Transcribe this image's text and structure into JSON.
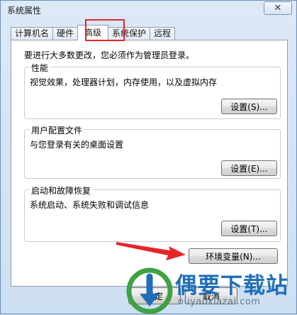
{
  "window": {
    "title": "系统属性",
    "close_glyph": "✕"
  },
  "tabs": [
    {
      "label": "计算机名",
      "active": false
    },
    {
      "label": "硬件",
      "active": false
    },
    {
      "label": "高级",
      "active": true
    },
    {
      "label": "系统保护",
      "active": false
    },
    {
      "label": "远程",
      "active": false
    }
  ],
  "intro": "要进行大多数更改，您必须作为管理员登录。",
  "groups": {
    "performance": {
      "title": "性能",
      "desc": "视觉效果，处理器计划，内存使用，以及虚拟内存",
      "button": "设置(S)..."
    },
    "profiles": {
      "title": "用户配置文件",
      "desc": "与您登录有关的桌面设置",
      "button": "设置(E)..."
    },
    "startup": {
      "title": "启动和故障恢复",
      "desc": "系统启动、系统失败和调试信息",
      "button": "设置(T)..."
    }
  },
  "env_button": "环境变量(N)...",
  "footer": {
    "ok": "确定",
    "cancel": "取消"
  },
  "watermark": {
    "text": "偶要下载站",
    "url": "ouyaoxiazai.com"
  },
  "colors": {
    "highlight": "#e5252a",
    "arrow": "#e5252a",
    "watermark_blue": "#1f6fb8",
    "watermark_green": "#3ea142"
  },
  "icons": {
    "close": "close-icon",
    "arrow": "red-arrow-icon",
    "logo": "download-site-logo-icon"
  }
}
